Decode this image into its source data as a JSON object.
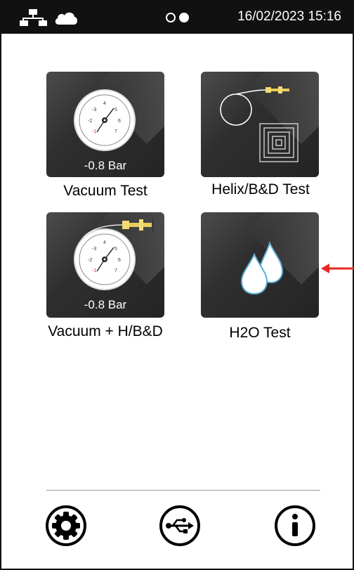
{
  "status_bar": {
    "network_icon": "network-icon",
    "cloud_icon": "cloud-icon",
    "indicator_icon": "toggle-dots-icon",
    "datetime": "16/02/2023 15:16"
  },
  "tiles": [
    {
      "id": "vacuum-test",
      "label": "Vacuum Test",
      "caption": "-0.8 Bar",
      "icon": "pressure-gauge-icon"
    },
    {
      "id": "helix-bd-test",
      "label": "Helix/B&D Test",
      "caption": "",
      "icon": "helix-tube-icon"
    },
    {
      "id": "vacuum-helix-bd",
      "label": "Vacuum + H/B&D",
      "caption": "-0.8 Bar",
      "icon": "gauge-with-helix-icon"
    },
    {
      "id": "h2o-test",
      "label": "H2O Test",
      "caption": "",
      "icon": "water-drops-icon"
    }
  ],
  "bottom_bar": {
    "settings_icon": "gear-icon",
    "usb_icon": "usb-icon",
    "info_icon": "info-icon"
  },
  "colors": {
    "status_bar_bg": "#111111",
    "tile_bg": "#2f2f2f",
    "arrow": "#e8281e"
  }
}
